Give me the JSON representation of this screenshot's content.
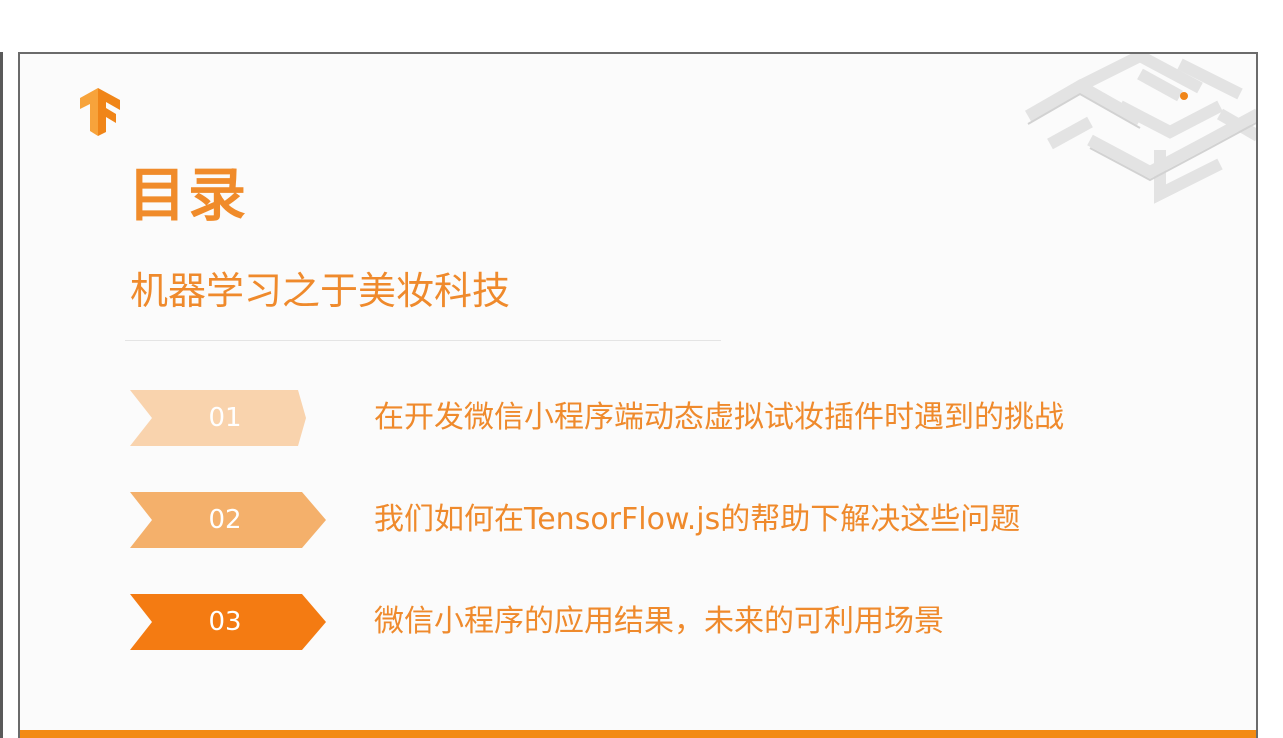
{
  "slide": {
    "title": "目录",
    "subtitle": "机器学习之于美妆科技",
    "items": [
      {
        "number": "01",
        "text": "在开发微信小程序端动态虚拟试妆插件时遇到的挑战",
        "color": "#f9d3ad"
      },
      {
        "number": "02",
        "text": "我们如何在TensorFlow.js的帮助下解决这些问题",
        "color": "#f4b06b"
      },
      {
        "number": "03",
        "text": "微信小程序的应用结果，未来的可利用场景",
        "color": "#f47b12"
      }
    ]
  },
  "colors": {
    "accent": "#ef8a2c",
    "bottom_bar": "#f38a13",
    "logo": "#f39324"
  },
  "icons": {
    "logo": "tensorflow-logo",
    "decoration": "maze-decoration"
  }
}
